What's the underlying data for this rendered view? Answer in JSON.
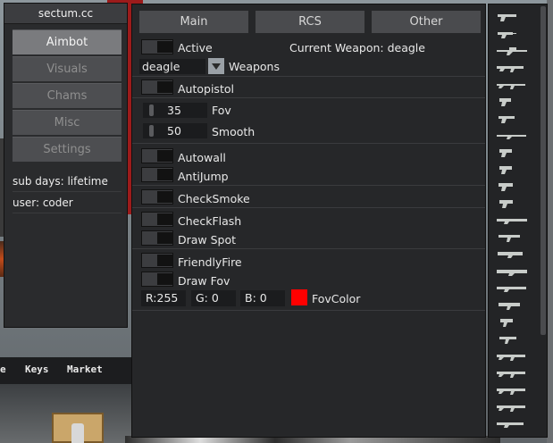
{
  "background": {
    "tabs": [
      "e",
      "Keys",
      "Market"
    ]
  },
  "sidebar": {
    "title": "sectum.cc",
    "items": [
      {
        "label": "Aimbot",
        "active": true
      },
      {
        "label": "Visuals",
        "active": false
      },
      {
        "label": "Chams",
        "active": false
      },
      {
        "label": "Misc",
        "active": false
      },
      {
        "label": "Settings",
        "active": false
      }
    ],
    "sub_days": "sub days:  lifetime",
    "user": "user:  coder"
  },
  "main": {
    "tabs": [
      "Main",
      "RCS",
      "Other"
    ],
    "active_label": "Active",
    "current_weapon": "Current Weapon: deagle",
    "weapon_select": "deagle",
    "weapons_label": "Weapons",
    "autopistol": "Autopistol",
    "fov_value": "35",
    "fov_label": "Fov",
    "smooth_value": "50",
    "smooth_label": "Smooth",
    "autowall": "Autowall",
    "antijump": "AntiJump",
    "checksmoke": "CheckSmoke",
    "checkflash": "CheckFlash",
    "drawspot": "Draw Spot",
    "friendlyfire": "FriendlyFire",
    "drawfov": "Draw Fov",
    "rgb_r": "R:255",
    "rgb_g": "G:  0",
    "rgb_b": "B:  0",
    "fovcolor_label": "FovColor",
    "fovcolor": "#ff0000"
  },
  "weapons": {
    "icons": [
      "deagle-icon",
      "revolver-icon",
      "awp-icon",
      "ak47-icon",
      "m4-icon",
      "glock-icon",
      "usp-icon",
      "scout-icon",
      "p250-icon",
      "fiveseven-icon",
      "cz75-icon",
      "tec9-icon",
      "shotgun-icon",
      "mp7-icon",
      "p90-icon",
      "m249-icon",
      "nova-icon",
      "ump-icon",
      "mac10-icon",
      "mp9-icon",
      "galil-icon",
      "famas-icon",
      "sg553-icon",
      "aug-icon",
      "xm1014-icon"
    ]
  }
}
